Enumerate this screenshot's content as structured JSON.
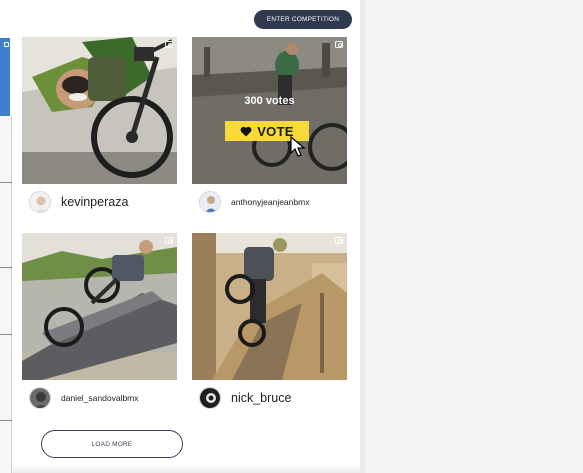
{
  "header": {
    "enter_competition_label": "ENTER COMPETITION"
  },
  "posts": [
    {
      "username": "kevinperaza",
      "platform_icon": "instagram-icon",
      "avatar_icon": "avatar-icon"
    },
    {
      "username": "anthonyjeanjeanbmx",
      "platform_icon": "instagram-icon",
      "avatar_icon": "avatar-icon",
      "votes_text": "300 votes",
      "vote_label": "VOTE",
      "vote_icon": "heart-icon",
      "vote_color": "#f7d93a"
    },
    {
      "username": "daniel_sandovalbmx",
      "platform_icon": "instagram-icon",
      "avatar_icon": "avatar-icon"
    },
    {
      "username": "nick_bruce",
      "platform_icon": "instagram-icon",
      "avatar_icon": "avatar-icon"
    }
  ],
  "footer": {
    "load_more_label": "LOAD MORE"
  },
  "colors": {
    "button_dark": "#2f3a4f",
    "accent_blue": "#3f7fd1",
    "vote_yellow": "#f7d93a"
  }
}
